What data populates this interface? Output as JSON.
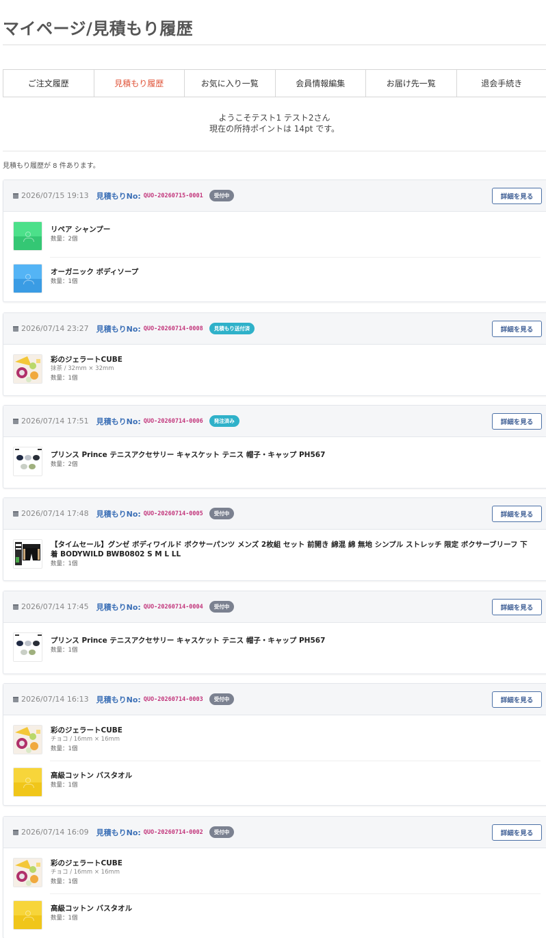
{
  "page_title": "マイページ/見積もり履歴",
  "tabs": [
    {
      "label": "ご注文履歴"
    },
    {
      "label": "見積もり履歴"
    },
    {
      "label": "お気に入り一覧"
    },
    {
      "label": "会員情報編集"
    },
    {
      "label": "お届け先一覧"
    },
    {
      "label": "退会手続き"
    }
  ],
  "welcome": {
    "line1": "ようこそテスト1 テスト2さん",
    "line2": "現在の所持ポイントは 14pt です。"
  },
  "count_text": "見積もり履歴が 8 件あります。",
  "quo_label": "見積もりNo:",
  "detail_label": "詳細を見る",
  "colors": {
    "accent_tab": "#e0573c",
    "quo_label": "#3b6fb6",
    "quo_number": "#c2357b",
    "badge_gray": "#7b8190",
    "badge_teal": "#2fb1c9"
  },
  "quotes": [
    {
      "date": "2026/07/15 19:13",
      "number": "QUO-20260715-0001",
      "status": "受付中",
      "items": [
        {
          "name": "リペア シャンプー",
          "option": "",
          "qty": "数量：2個",
          "thumb": "placeholder-green"
        },
        {
          "name": "オーガニック ボディソープ",
          "option": "",
          "qty": "数量：1個",
          "thumb": "placeholder-blue"
        }
      ]
    },
    {
      "date": "2026/07/14 23:27",
      "number": "QUO-20260714-0008",
      "status": "見積もり送付済",
      "items": [
        {
          "name": "彩のジェラートCUBE",
          "option": "抹茶 / 32mm × 32mm",
          "qty": "数量：1個",
          "thumb": "gelato-photo"
        }
      ]
    },
    {
      "date": "2026/07/14 17:51",
      "number": "QUO-20260714-0006",
      "status": "発注済み",
      "items": [
        {
          "name": "プリンス Prince テニスアクセサリー キャスケット テニス 帽子・キャップ PH567",
          "option": "",
          "qty": "数量：2個",
          "thumb": "cap-photo"
        }
      ]
    },
    {
      "date": "2026/07/14 17:48",
      "number": "QUO-20260714-0005",
      "status": "受付中",
      "items": [
        {
          "name": "【タイムセール】グンゼ ボディワイルド ボクサーパンツ メンズ 2枚組 セット 前開き 綿混 綿 無地 シンプル ストレッチ 限定 ボクサーブリーフ 下着 BODYWILD BWB0802 S M L LL",
          "option": "",
          "qty": "数量：1個",
          "thumb": "boxer-photo"
        }
      ]
    },
    {
      "date": "2026/07/14 17:45",
      "number": "QUO-20260714-0004",
      "status": "受付中",
      "items": [
        {
          "name": "プリンス Prince テニスアクセサリー キャスケット テニス 帽子・キャップ PH567",
          "option": "",
          "qty": "数量：1個",
          "thumb": "cap-photo"
        }
      ]
    },
    {
      "date": "2026/07/14 16:13",
      "number": "QUO-20260714-0003",
      "status": "受付中",
      "items": [
        {
          "name": "彩のジェラートCUBE",
          "option": "チョコ / 16mm × 16mm",
          "qty": "数量：1個",
          "thumb": "gelato-photo"
        },
        {
          "name": "高級コットン バスタオル",
          "option": "",
          "qty": "数量：1個",
          "thumb": "placeholder-yellow"
        }
      ]
    },
    {
      "date": "2026/07/14 16:09",
      "number": "QUO-20260714-0002",
      "status": "受付中",
      "items": [
        {
          "name": "彩のジェラートCUBE",
          "option": "チョコ / 16mm × 16mm",
          "qty": "数量：1個",
          "thumb": "gelato-photo"
        },
        {
          "name": "高級コットン バスタオル",
          "option": "",
          "qty": "数量：1個",
          "thumb": "placeholder-yellow"
        }
      ]
    }
  ]
}
